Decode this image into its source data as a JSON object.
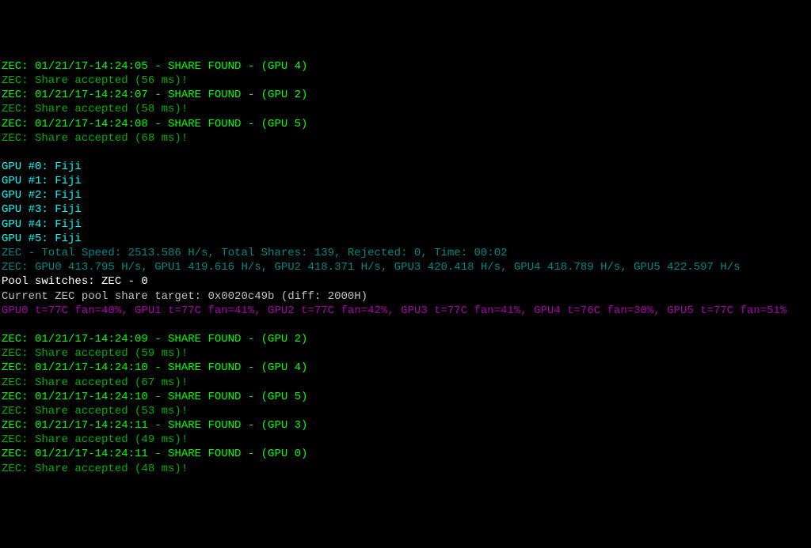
{
  "lines": [
    {
      "style": "green-bright",
      "text": "ZEC: 01/21/17-14:24:05 - SHARE FOUND - (GPU 4)"
    },
    {
      "style": "green-dark",
      "text": "ZEC: Share accepted (56 ms)!"
    },
    {
      "style": "green-bright",
      "text": "ZEC: 01/21/17-14:24:07 - SHARE FOUND - (GPU 2)"
    },
    {
      "style": "green-dark",
      "text": "ZEC: Share accepted (58 ms)!"
    },
    {
      "style": "green-bright",
      "text": "ZEC: 01/21/17-14:24:08 - SHARE FOUND - (GPU 5)"
    },
    {
      "style": "green-dark",
      "text": "ZEC: Share accepted (68 ms)!"
    },
    {
      "style": "blank",
      "text": ""
    },
    {
      "style": "cyan-bright",
      "text": "GPU #0: Fiji"
    },
    {
      "style": "cyan-bright",
      "text": "GPU #1: Fiji"
    },
    {
      "style": "cyan-bright",
      "text": "GPU #2: Fiji"
    },
    {
      "style": "cyan-bright",
      "text": "GPU #3: Fiji"
    },
    {
      "style": "cyan-bright",
      "text": "GPU #4: Fiji"
    },
    {
      "style": "cyan-bright",
      "text": "GPU #5: Fiji"
    },
    {
      "style": "teal",
      "text": "ZEC - Total Speed: 2513.586 H/s, Total Shares: 139, Rejected: 0, Time: 00:02"
    },
    {
      "style": "teal",
      "text": "ZEC: GPU0 413.795 H/s, GPU1 419.616 H/s, GPU2 418.371 H/s, GPU3 420.418 H/s, GPU4 418.789 H/s, GPU5 422.597 H/s"
    },
    {
      "style": "white",
      "text": "Pool switches: ZEC - 0"
    },
    {
      "style": "gray",
      "text": "Current ZEC pool share target: 0x0020c49b (diff: 2000H)"
    },
    {
      "style": "magenta-dark",
      "text": "GPU0 t=77C fan=40%, GPU1 t=77C fan=41%, GPU2 t=77C fan=42%, GPU3 t=77C fan=41%, GPU4 t=76C fan=30%, GPU5 t=77C fan=51%"
    },
    {
      "style": "blank",
      "text": ""
    },
    {
      "style": "green-bright",
      "text": "ZEC: 01/21/17-14:24:09 - SHARE FOUND - (GPU 2)"
    },
    {
      "style": "green-dark",
      "text": "ZEC: Share accepted (59 ms)!"
    },
    {
      "style": "green-bright",
      "text": "ZEC: 01/21/17-14:24:10 - SHARE FOUND - (GPU 4)"
    },
    {
      "style": "green-dark",
      "text": "ZEC: Share accepted (67 ms)!"
    },
    {
      "style": "green-bright",
      "text": "ZEC: 01/21/17-14:24:10 - SHARE FOUND - (GPU 5)"
    },
    {
      "style": "green-dark",
      "text": "ZEC: Share accepted (53 ms)!"
    },
    {
      "style": "green-bright",
      "text": "ZEC: 01/21/17-14:24:11 - SHARE FOUND - (GPU 3)"
    },
    {
      "style": "green-dark",
      "text": "ZEC: Share accepted (49 ms)!"
    },
    {
      "style": "green-bright",
      "text": "ZEC: 01/21/17-14:24:11 - SHARE FOUND - (GPU 0)"
    },
    {
      "style": "green-dark",
      "text": "ZEC: Share accepted (48 ms)!"
    }
  ]
}
